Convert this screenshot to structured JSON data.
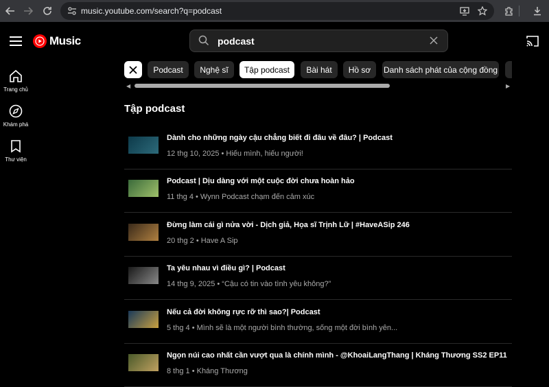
{
  "browser": {
    "url": "music.youtube.com/search?q=podcast",
    "icons": [
      "back-icon",
      "forward-icon",
      "reload-icon",
      "site-settings-icon",
      "install-app-icon",
      "bookmark-star-icon",
      "extensions-icon",
      "download-icon"
    ]
  },
  "header": {
    "logo_text": "Music",
    "search_query": "podcast",
    "icons": [
      "menu-icon",
      "search-icon",
      "clear-icon",
      "cast-icon"
    ]
  },
  "sidebar": {
    "items": [
      {
        "label": "Trang chủ",
        "icon": "home-icon"
      },
      {
        "label": "Khám phá",
        "icon": "explore-icon"
      },
      {
        "label": "Thư viện",
        "icon": "library-icon"
      }
    ]
  },
  "filters": {
    "chips": [
      {
        "label": "Podcast",
        "active": false
      },
      {
        "label": "Nghệ sĩ",
        "active": false
      },
      {
        "label": "Tập podcast",
        "active": true
      },
      {
        "label": "Bài hát",
        "active": false
      },
      {
        "label": "Hồ sơ",
        "active": false
      },
      {
        "label": "Danh sách phát của cộng đồng",
        "active": false
      }
    ]
  },
  "results": {
    "section_title": "Tập podcast",
    "items": [
      {
        "title": "Dành cho những ngày cậu chẳng biết đi đâu về đâu? | Podcast",
        "subtitle": "12 thg 10, 2025 • Hiếu mình, hiếu người!",
        "thumb_colors": [
          "#0d3a4a",
          "#2d6a7a"
        ]
      },
      {
        "title": "Podcast | Dịu dàng với một cuộc đời chưa hoàn hảo",
        "subtitle": "11 thg 4 • Wynn Podcast chạm đến cảm xúc",
        "thumb_colors": [
          "#3b6b3b",
          "#9fc06a"
        ]
      },
      {
        "title": "Đừng làm cái gì nửa vời - Dịch giả, Họa sĩ Trịnh Lữ | #HaveASip 246",
        "subtitle": "20 thg 2 • Have A Sip",
        "thumb_colors": [
          "#3a2a1a",
          "#b08040"
        ]
      },
      {
        "title": "Ta yêu nhau vì điều gì? | Podcast",
        "subtitle": "14 thg 9, 2025 • “Cậu có tin vào tình yêu không?”",
        "thumb_colors": [
          "#1a1a1a",
          "#888888"
        ]
      },
      {
        "title": "Nếu cả đời không rực rỡ thì sao?| Podcast",
        "subtitle": "5 thg 4 • Mình sẽ là một người bình thường, sống một đời bình yên...",
        "thumb_colors": [
          "#1a3a5a",
          "#c8a040"
        ]
      },
      {
        "title": "Ngọn núi cao nhất cần vượt qua là chính mình - @KhoaiLangThang | Kháng Thương SS2 EP11",
        "subtitle": "8 thg 1 • Kháng Thương",
        "thumb_colors": [
          "#4a5a2a",
          "#c0a060"
        ]
      }
    ]
  }
}
